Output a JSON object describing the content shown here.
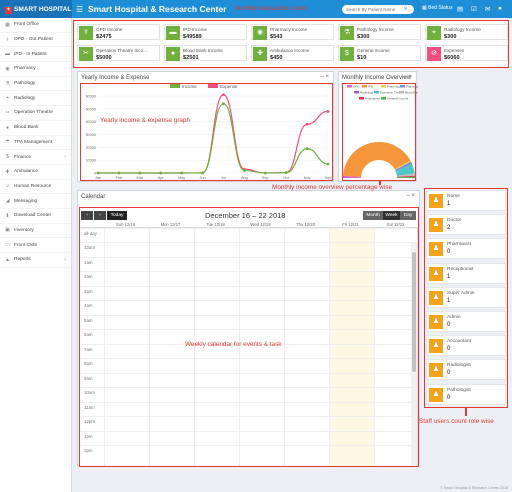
{
  "app": {
    "logo_text": "SMART HOSPITAL",
    "title": "Smart Hospital & Research Center",
    "search_placeholder": "Search By Patient Name",
    "status_label": "Bed Status"
  },
  "sidebar": {
    "items": [
      {
        "label": "Front Office",
        "icon": "calendar-icon",
        "chev": false
      },
      {
        "label": "OPD - Out Patient",
        "icon": "stethoscope-icon",
        "chev": false
      },
      {
        "label": "IPD - In Patient",
        "icon": "bed-icon",
        "chev": false
      },
      {
        "label": "Pharmacy",
        "icon": "pill-icon",
        "chev": false
      },
      {
        "label": "Pathology",
        "icon": "flask-icon",
        "chev": false
      },
      {
        "label": "Radiology",
        "icon": "microscope-icon",
        "chev": false
      },
      {
        "label": "Operation Theatre",
        "icon": "scissors-icon",
        "chev": false
      },
      {
        "label": "Blood Bank",
        "icon": "droplet-icon",
        "chev": false
      },
      {
        "label": "TPA Management",
        "icon": "umbrella-icon",
        "chev": false
      },
      {
        "label": "Finance",
        "icon": "money-icon",
        "chev": true
      },
      {
        "label": "Ambulance",
        "icon": "ambulance-icon",
        "chev": false
      },
      {
        "label": "Human Resource",
        "icon": "users-icon",
        "chev": false
      },
      {
        "label": "Messaging",
        "icon": "bullhorn-icon",
        "chev": false
      },
      {
        "label": "Download Center",
        "icon": "download-icon",
        "chev": false
      },
      {
        "label": "Inventory",
        "icon": "box-icon",
        "chev": false
      },
      {
        "label": "Front CMS",
        "icon": "cms-icon",
        "chev": false
      },
      {
        "label": "Reports",
        "icon": "chart-icon",
        "chev": true
      }
    ]
  },
  "income": [
    {
      "label": "OPD Income",
      "value": "$2475",
      "icon": "stethoscope-icon",
      "color": "#6fb13c"
    },
    {
      "label": "IPD Income",
      "value": "$49589",
      "icon": "bed-icon",
      "color": "#6fb13c"
    },
    {
      "label": "Pharmacy Income",
      "value": "$543",
      "icon": "pill-icon",
      "color": "#6fb13c"
    },
    {
      "label": "Pathology Income",
      "value": "$300",
      "icon": "flask-icon",
      "color": "#6fb13c"
    },
    {
      "label": "Radiology Income",
      "value": "$300",
      "icon": "microscope-icon",
      "color": "#6fb13c"
    },
    {
      "label": "Operation Theatre Inco...",
      "value": "$5000",
      "icon": "scissors-icon",
      "color": "#6fb13c"
    },
    {
      "label": "Blood Bank Income",
      "value": "$2501",
      "icon": "droplet-icon",
      "color": "#6fb13c"
    },
    {
      "label": "Ambulance Income",
      "value": "$450",
      "icon": "ambulance-icon",
      "color": "#6fb13c"
    },
    {
      "label": "General Income",
      "value": "$10",
      "icon": "money-icon",
      "color": "#6fb13c"
    },
    {
      "label": "Expenses",
      "value": "$6060",
      "icon": "ban-icon",
      "color": "#f54e7e"
    }
  ],
  "annotations": {
    "transaction": "Monthly transaction count",
    "yearly": "Yearly income & expense graph",
    "monthly": "Monthly income overview percentage wise",
    "calendar": "Weekly calendar for events & task",
    "staff": "Staff users count role wise"
  },
  "yearly": {
    "title": "Yearly Income & Expense",
    "legend_income": "Income",
    "legend_expense": "Expense"
  },
  "chart_data": [
    {
      "type": "line",
      "title": "Yearly Income & Expense",
      "x": [
        "Jan",
        "Feb",
        "Mar",
        "Apr",
        "May",
        "Jun",
        "Jul",
        "Aug",
        "Sep",
        "Oct",
        "Nov",
        "Dec"
      ],
      "ylim": [
        0,
        60000
      ],
      "yticks": [
        0,
        10000,
        20000,
        30000,
        40000,
        50000,
        60000
      ],
      "series": [
        {
          "name": "Income",
          "color": "#6fb13c",
          "values": [
            0,
            0,
            0,
            0,
            0,
            100,
            54000,
            2000,
            0,
            300,
            19000,
            7000
          ]
        },
        {
          "name": "Expense",
          "color": "#f54e7e",
          "values": [
            0,
            0,
            0,
            0,
            0,
            100,
            61000,
            3000,
            0,
            300,
            38000,
            48000
          ]
        }
      ]
    },
    {
      "type": "pie",
      "title": "Monthly Income Overview",
      "categories": [
        "OPD",
        "IPD",
        "Pharmacy",
        "Pathology",
        "Radiology",
        "Operation Theatre",
        "Blood Bank",
        "Ambulance",
        "General Income"
      ],
      "colors": [
        "#e066c8",
        "#f5963a",
        "#f3d04a",
        "#5c9bdc",
        "#9d5fd0",
        "#4dc7c7",
        "#bbbbbb",
        "#e8344a",
        "#46b04f"
      ],
      "values": [
        2,
        82,
        1,
        1,
        1,
        9,
        2,
        1,
        1
      ]
    }
  ],
  "monthly": {
    "title": "Monthly Income Overview"
  },
  "calendar": {
    "title": "Calendar",
    "range": "December 16 – 22 2018",
    "today_label": "Today",
    "views": [
      "Month",
      "Week",
      "Day"
    ],
    "days": [
      "Sun 12/16",
      "Mon 12/17",
      "Tue 12/18",
      "Wed 12/19",
      "Thu 12/20",
      "Fri 12/21",
      "Sat 12/22"
    ],
    "allday": "all-day",
    "times": [
      "12am",
      "1am",
      "2am",
      "3am",
      "4am",
      "5am",
      "6am",
      "7am",
      "8am",
      "9am",
      "10am",
      "11am",
      "12pm",
      "1pm",
      "2pm"
    ]
  },
  "staff": [
    {
      "role": "Nurse",
      "count": "1"
    },
    {
      "role": "Doctor",
      "count": "2"
    },
    {
      "role": "Pharmacist",
      "count": "0"
    },
    {
      "role": "Receptionist",
      "count": "1"
    },
    {
      "role": "Super Admin",
      "count": "1"
    },
    {
      "role": "Admin",
      "count": "0"
    },
    {
      "role": "Accountant",
      "count": "0"
    },
    {
      "role": "Radiologist",
      "count": "0"
    },
    {
      "role": "Pathologist",
      "count": "0"
    }
  ],
  "footer": "© Smart Hospital & Research Center 2018"
}
